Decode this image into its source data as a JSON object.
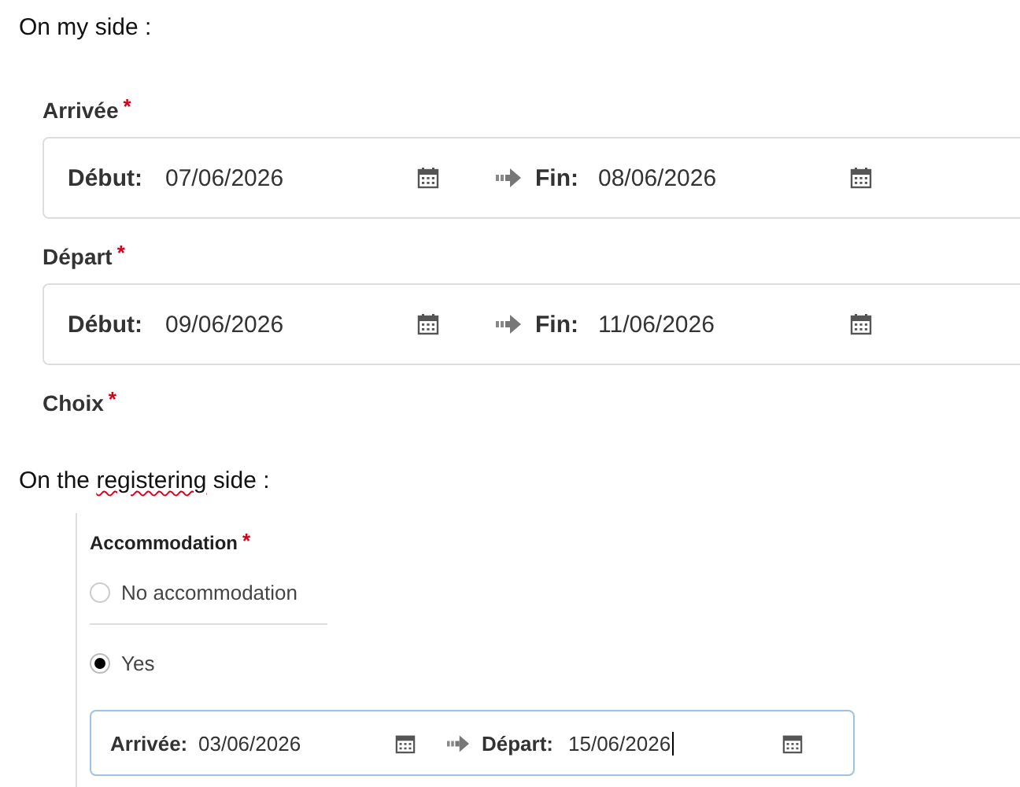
{
  "intro": "On my side :",
  "date_ranges": [
    {
      "label": "Arrivée",
      "required_mark": "*",
      "start_label": "Début:",
      "start_value": "07/06/2026",
      "end_label": "Fin:",
      "end_value": "08/06/2026"
    },
    {
      "label": "Départ",
      "required_mark": "*",
      "start_label": "Début:",
      "start_value": "09/06/2026",
      "end_label": "Fin:",
      "end_value": "11/06/2026"
    }
  ],
  "choice": {
    "label": "Choix",
    "required_mark": "*"
  },
  "registering_intro": [
    {
      "text": "On the ",
      "misspelled": false
    },
    {
      "text": "registering",
      "misspelled": true
    },
    {
      "text": " side :",
      "misspelled": false
    }
  ],
  "accommodation": {
    "label": "Accommodation",
    "required_mark": "*",
    "options": [
      {
        "label": "No accommodation",
        "selected": false
      },
      {
        "label": "Yes",
        "selected": true
      }
    ],
    "date_range": {
      "start_label": "Arrivée:",
      "start_value": "03/06/2026",
      "end_label": "Départ:",
      "end_value": "15/06/2026",
      "focused": true
    }
  }
}
